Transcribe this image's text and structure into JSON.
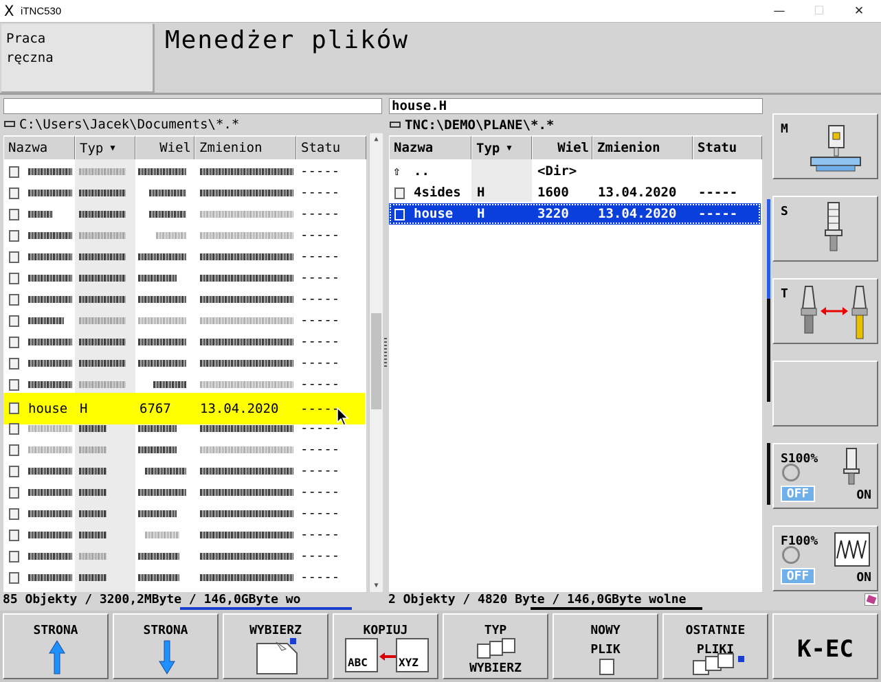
{
  "window": {
    "title": "iTNC530",
    "logo": "X",
    "min": "—",
    "max": "☐",
    "close": "✕"
  },
  "header": {
    "mode_line1": "Praca",
    "mode_line2": "ręczna",
    "title": "Menedżer plików"
  },
  "left_pane": {
    "search_value": "",
    "path": "C:\\Users\\Jacek\\Documents\\*.*",
    "columns": [
      "Nazwa",
      "Typ",
      "Wiel",
      "Zmienion",
      "Statu"
    ],
    "visible_rows": [
      {
        "status": "-----"
      },
      {
        "status": "-----"
      },
      {
        "status": "-----"
      },
      {
        "status": "-----"
      },
      {
        "status": "-----"
      },
      {
        "status": "-----"
      },
      {
        "status": "-----"
      },
      {
        "status": "-----"
      },
      {
        "status": "-----"
      },
      {
        "status": "-----"
      },
      {
        "status": "-----"
      }
    ],
    "selected_row": {
      "name": "house",
      "type": "H",
      "size": "6767",
      "modified": "13.04.2020",
      "status": "-----"
    },
    "rows_after": [
      {
        "status": "-----"
      },
      {
        "status": "-----"
      },
      {
        "status": "-----"
      },
      {
        "status": "-----"
      },
      {
        "status": "-----"
      },
      {
        "status": "-----"
      },
      {
        "status": "-----"
      },
      {
        "status": "-----"
      }
    ],
    "status_line": "85 Objekty / 3200,2MByte / 146,0GByte wo"
  },
  "right_pane": {
    "search_value": "house.H",
    "path": "TNC:\\DEMO\\PLANE\\*.*",
    "columns": [
      "Nazwa",
      "Typ",
      "Wiel",
      "Zmienion",
      "Statu"
    ],
    "rows": [
      {
        "name": "..",
        "type": "",
        "size": "<Dir>",
        "modified": "",
        "status": ""
      },
      {
        "name": "4sides",
        "type": "H",
        "size": "1600",
        "modified": "13.04.2020",
        "status": "-----"
      },
      {
        "name": "house",
        "type": "H",
        "size": "3220",
        "modified": "13.04.2020",
        "status": "-----"
      }
    ],
    "status_line": "2 Objekty / 4820 Byte / 146,0GByte wolne"
  },
  "side_panel": {
    "m_label": "M",
    "s_label": "S",
    "t_label": "T",
    "s_override": {
      "label": "S100%",
      "off": "OFF",
      "on": "ON"
    },
    "f_override": {
      "label": "F100%",
      "off": "OFF",
      "on": "ON"
    }
  },
  "softkeys": [
    {
      "line1": "STRONA",
      "line2": "",
      "line3": ""
    },
    {
      "line1": "STRONA",
      "line2": "",
      "line3": ""
    },
    {
      "line1": "WYBIERZ",
      "line2": "",
      "line3": ""
    },
    {
      "line1": "KOPIUJ",
      "line2": "ABC",
      "line3": "XYZ"
    },
    {
      "line1": "TYP",
      "line2": "",
      "line3": "WYBIERZ"
    },
    {
      "line1": "NOWY",
      "line2": "PLIK",
      "line3": ""
    },
    {
      "line1": "OSTATNIE",
      "line2": "PLIKI",
      "line3": ""
    },
    {
      "line1": "K-EC",
      "line2": "",
      "line3": ""
    }
  ],
  "colors": {
    "selected_row": "#ffff00",
    "highlight_row": "#0a3fdc",
    "off_badge": "#6fb0ea",
    "arrow": "#1e90ff"
  }
}
